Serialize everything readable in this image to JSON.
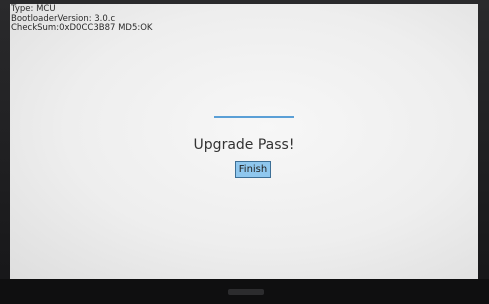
{
  "info": {
    "type_line": "Type: MCU",
    "bootloader_line": "BootloaderVersion: 3.0.c",
    "checksum_line": "CheckSum:0xD0CC3B87 MD5:OK"
  },
  "main": {
    "status_text": "Upgrade Pass!",
    "finish_label": "Finish",
    "progress_fraction": 1.0
  },
  "colors": {
    "screen_bg": "#eeeeee",
    "accent": "#8fc7ee",
    "progress": "#5a9fd6"
  }
}
